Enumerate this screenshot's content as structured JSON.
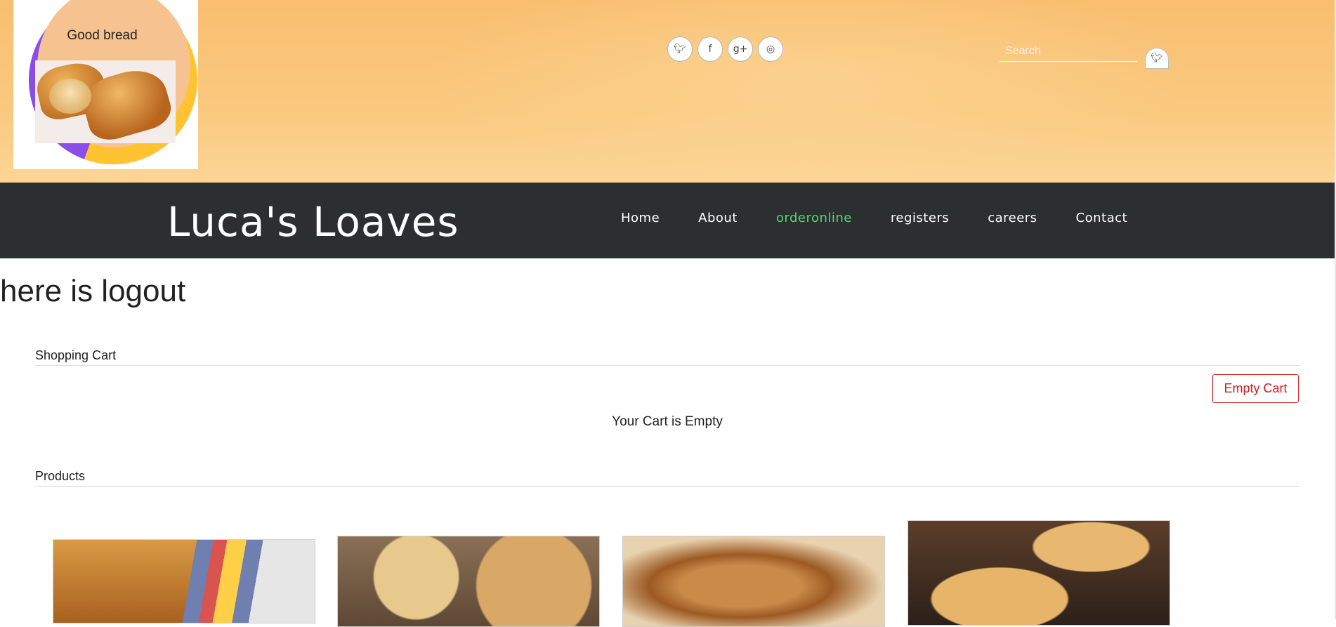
{
  "banner": {
    "logo_text": "Good bread",
    "social": [
      {
        "icon": "twitter-icon",
        "glyph": "🐦︎"
      },
      {
        "icon": "facebook-icon",
        "glyph": "f"
      },
      {
        "icon": "google-plus-icon",
        "glyph": "g+"
      },
      {
        "icon": "dribbble-icon",
        "glyph": "◎"
      }
    ],
    "search": {
      "placeholder": "Search",
      "button_icon": "twitter-icon"
    }
  },
  "navbar": {
    "brand": "Luca's Loaves",
    "links": [
      "Home",
      "About",
      "orderonline",
      "registers",
      "careers",
      "Contact"
    ],
    "active": "orderonline",
    "active_color": "#5bd17a",
    "background": "#2c2f2f"
  },
  "main": {
    "heading": "here is logout",
    "cart": {
      "title": "Shopping Cart",
      "empty_button": "Empty Cart",
      "empty_message": "Your Cart is Empty",
      "button_color": "#d11a1a"
    },
    "products": {
      "title": "Products",
      "items": [
        "sliced-bread-image",
        "artisan-loaves-image",
        "crusty-bread-image",
        "pies-image"
      ]
    }
  },
  "colors": {
    "banner": "#f9be6f"
  }
}
